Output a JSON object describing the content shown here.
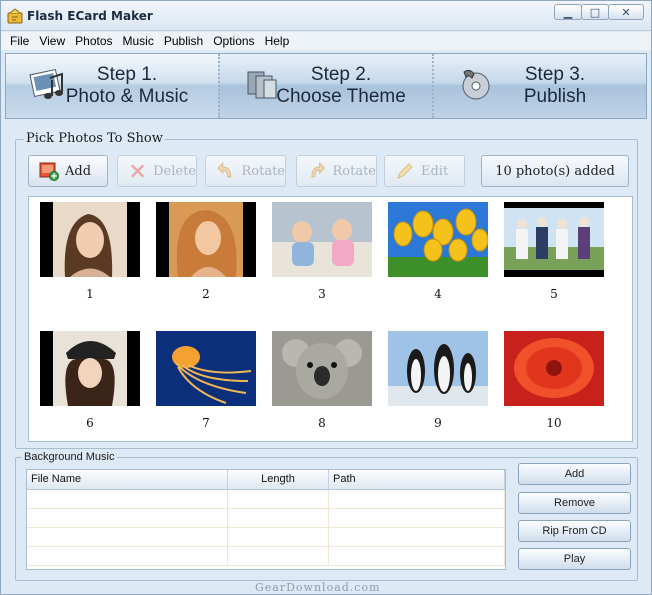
{
  "window": {
    "title": "Flash ECard Maker",
    "controls": {
      "minimize": "▁",
      "maximize": "□",
      "close": "✕"
    }
  },
  "menu": [
    "File",
    "View",
    "Photos",
    "Music",
    "Publish",
    "Options",
    "Help"
  ],
  "steps": [
    {
      "line1": "Step 1.",
      "line2": "Photo & Music",
      "icon": "photo-music-icon"
    },
    {
      "line1": "Step 2.",
      "line2": "Choose Theme",
      "icon": "theme-icon"
    },
    {
      "line1": "Step 3.",
      "line2": "Publish",
      "icon": "publish-disc-icon"
    }
  ],
  "photos_panel": {
    "title": "Pick Photos To Show",
    "toolbar": {
      "add": "Add",
      "delete": "Delete",
      "rotate_left": "Rotate",
      "rotate_right": "Rotate",
      "edit": "Edit"
    },
    "count": "10 photo(s) added",
    "photos": [
      {
        "number": "1",
        "subject": "portrait-woman"
      },
      {
        "number": "2",
        "subject": "portrait-woman-blonde"
      },
      {
        "number": "3",
        "subject": "babies"
      },
      {
        "number": "4",
        "subject": "yellow-tulips"
      },
      {
        "number": "5",
        "subject": "group-of-men"
      },
      {
        "number": "6",
        "subject": "woman-with-cap"
      },
      {
        "number": "7",
        "subject": "jellyfish"
      },
      {
        "number": "8",
        "subject": "koala"
      },
      {
        "number": "9",
        "subject": "penguins"
      },
      {
        "number": "10",
        "subject": "red-flower"
      }
    ]
  },
  "music_panel": {
    "title": "Background Music",
    "columns": [
      "File Name",
      "Length",
      "Path"
    ],
    "rows": [],
    "buttons": {
      "add": "Add",
      "remove": "Remove",
      "rip": "Rip From CD",
      "play": "Play"
    }
  },
  "watermark": "GearDownload.com",
  "colors": {
    "window_bg": "#dde9f4",
    "banner": "#bfd3e7",
    "accent_border": "#8aa6c2"
  }
}
